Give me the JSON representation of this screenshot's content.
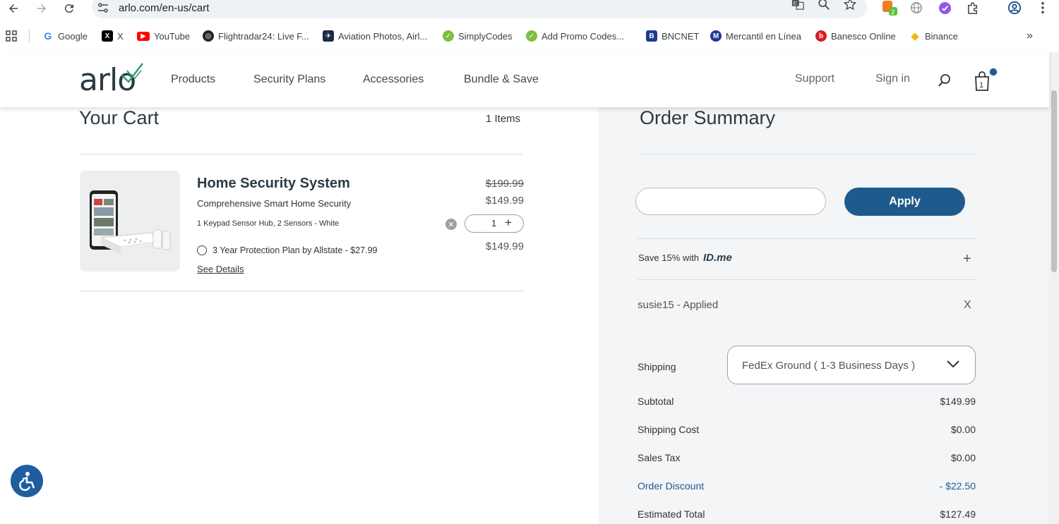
{
  "browser": {
    "url": "arlo.com/en-us/cart",
    "extension_badge": "2",
    "bookmarks": [
      {
        "label": "Google",
        "icon": "google-icon",
        "color": "#4285f4"
      },
      {
        "label": "X",
        "icon": "x-icon",
        "color": "#000000"
      },
      {
        "label": "YouTube",
        "icon": "youtube-icon",
        "color": "#ff0000"
      },
      {
        "label": "Flightradar24: Live F...",
        "icon": "flightradar-icon",
        "color": "#222222"
      },
      {
        "label": "Aviation Photos, Airl...",
        "icon": "aviation-icon",
        "color": "#1c2a44"
      },
      {
        "label": "SimplyCodes",
        "icon": "simplycodes-icon",
        "color": "#7bc043"
      },
      {
        "label": "Add Promo Codes...",
        "icon": "promo-icon",
        "color": "#7bc043"
      },
      {
        "label": "BNCNET",
        "icon": "bncnet-icon",
        "color": "#1f3a93"
      },
      {
        "label": "Mercantil en Línea",
        "icon": "mercantil-icon",
        "color": "#1f3a93"
      },
      {
        "label": "Banesco Online",
        "icon": "banesco-icon",
        "color": "#d81b23"
      },
      {
        "label": "Binance",
        "icon": "binance-icon",
        "color": "#f0b90b"
      }
    ]
  },
  "header": {
    "logo": "arlo",
    "nav": [
      "Products",
      "Security Plans",
      "Accessories",
      "Bundle & Save"
    ],
    "support": "Support",
    "sign_in": "Sign in",
    "cart_count": "1"
  },
  "cart": {
    "title": "Your Cart",
    "items_count": "1 Items",
    "item": {
      "name": "Home Security System",
      "subtitle": "Comprehensive Smart Home Security",
      "variant": "1 Keypad Sensor Hub, 2 Sensors - White",
      "plan": "3 Year Protection Plan by Allstate - $27.99",
      "details_link": "See Details",
      "price_original": "$199.99",
      "price_sale": "$149.99",
      "price_line_total": "$149.99",
      "quantity": "1"
    }
  },
  "summary": {
    "title": "Order Summary",
    "promo_placeholder": "",
    "apply_label": "Apply",
    "idme_text": "Save 15% with",
    "idme_brand": "ID.me",
    "applied_code": "susie15 - Applied",
    "shipping_label": "Shipping",
    "shipping_option": "FedEx Ground ( 1-3 Business Days )",
    "rows": [
      {
        "label": "Subtotal",
        "value": "$149.99"
      },
      {
        "label": "Shipping Cost",
        "value": "$0.00"
      },
      {
        "label": "Sales Tax",
        "value": "$0.00"
      },
      {
        "label": "Order Discount",
        "value": "- $22.50"
      },
      {
        "label": "Estimated Total",
        "value": "$127.49"
      }
    ]
  },
  "colors": {
    "accent": "#1e5a8c",
    "logo_mark": "#2f9e7a",
    "summary_bg": "#f3f5f7"
  }
}
